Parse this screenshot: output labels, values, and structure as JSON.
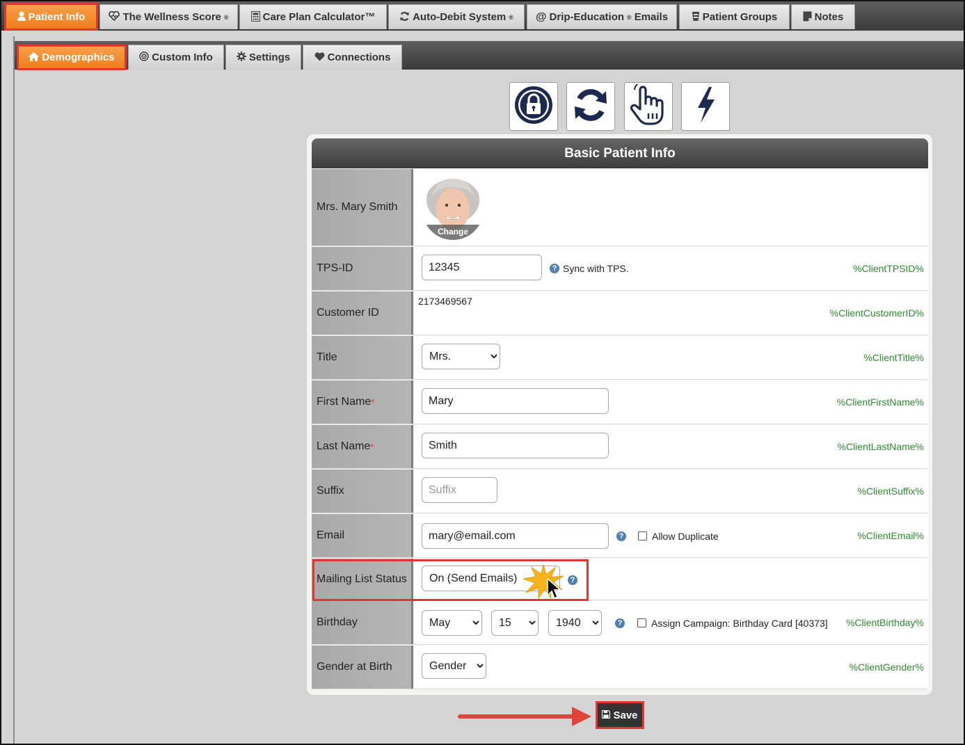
{
  "top_tabs": [
    {
      "label": "Patient Info",
      "icon": "user-icon",
      "active": true
    },
    {
      "label": "The Wellness Score",
      "icon": "heart-pulse-icon",
      "reg": "®"
    },
    {
      "label": "Care Plan Calculator™",
      "icon": "calculator-icon"
    },
    {
      "label": "Auto-Debit System",
      "icon": "refresh-icon",
      "reg": "®"
    },
    {
      "label": "Drip-Education",
      "icon": "at-icon",
      "reg": "®",
      "suffix": "Emails"
    },
    {
      "label": "Patient Groups",
      "icon": "group-icon"
    },
    {
      "label": "Notes",
      "icon": "notes-icon"
    }
  ],
  "sub_tabs": [
    {
      "label": "Demographics",
      "icon": "home-icon",
      "active": true
    },
    {
      "label": "Custom Info",
      "icon": "target-icon"
    },
    {
      "label": "Settings",
      "icon": "gear-icon"
    },
    {
      "label": "Connections",
      "icon": "heart-icon"
    }
  ],
  "action_icons": [
    "lock-icon",
    "sync-icon",
    "pointer-hand-icon",
    "lightning-icon"
  ],
  "card": {
    "title": "Basic Patient Info",
    "patient_name": "Mrs. Mary Smith",
    "avatar_change_label": "Change",
    "rows": {
      "tps_id": {
        "label": "TPS-ID",
        "value": "12345",
        "note": "Sync with TPS.",
        "var": "%ClientTPSID%"
      },
      "customer_id": {
        "label": "Customer ID",
        "value": "2173469567",
        "var": "%ClientCustomerID%"
      },
      "title": {
        "label": "Title",
        "value": "Mrs.",
        "var": "%ClientTitle%"
      },
      "first_name": {
        "label": "First Name",
        "required": "*",
        "value": "Mary",
        "var": "%ClientFirstName%"
      },
      "last_name": {
        "label": "Last Name",
        "required": "*",
        "value": "Smith",
        "var": "%ClientLastName%"
      },
      "suffix": {
        "label": "Suffix",
        "placeholder": "Suffix",
        "var": "%ClientSuffix%"
      },
      "email": {
        "label": "Email",
        "value": "mary@email.com",
        "checkbox_label": "Allow Duplicate",
        "var": "%ClientEmail%"
      },
      "mailing_list": {
        "label": "Mailing List Status",
        "value": "On (Send Emails)"
      },
      "birthday": {
        "label": "Birthday",
        "month": "May",
        "day": "15",
        "year": "1940",
        "checkbox_label": "Assign Campaign: Birthday Card [40373]",
        "var": "%ClientBirthday%"
      },
      "gender": {
        "label": "Gender at Birth",
        "value": "Gender",
        "var": "%ClientGender%"
      }
    }
  },
  "help_glyph": "?",
  "save_label": "Save",
  "colors": {
    "accent": "#ef7d1c",
    "highlight": "#e0372e",
    "variable": "#2e8b2e",
    "icon_navy": "#1b2a4e"
  }
}
